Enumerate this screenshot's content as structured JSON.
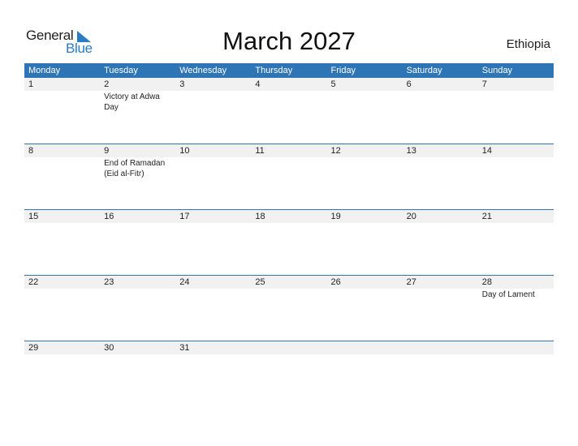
{
  "logo": {
    "part1": "General",
    "part2": "Blue",
    "icon": "triangle-flag-icon"
  },
  "title": "March 2027",
  "country": "Ethiopia",
  "colors": {
    "accent": "#2e75b6",
    "strip": "#f1f1f1"
  },
  "weekdays": [
    "Monday",
    "Tuesday",
    "Wednesday",
    "Thursday",
    "Friday",
    "Saturday",
    "Sunday"
  ],
  "weeks": [
    {
      "days": [
        {
          "num": "1",
          "event": ""
        },
        {
          "num": "2",
          "event": "Victory at Adwa Day"
        },
        {
          "num": "3",
          "event": ""
        },
        {
          "num": "4",
          "event": ""
        },
        {
          "num": "5",
          "event": ""
        },
        {
          "num": "6",
          "event": ""
        },
        {
          "num": "7",
          "event": ""
        }
      ]
    },
    {
      "days": [
        {
          "num": "8",
          "event": ""
        },
        {
          "num": "9",
          "event": "End of Ramadan (Eid al-Fitr)"
        },
        {
          "num": "10",
          "event": ""
        },
        {
          "num": "11",
          "event": ""
        },
        {
          "num": "12",
          "event": ""
        },
        {
          "num": "13",
          "event": ""
        },
        {
          "num": "14",
          "event": ""
        }
      ]
    },
    {
      "days": [
        {
          "num": "15",
          "event": ""
        },
        {
          "num": "16",
          "event": ""
        },
        {
          "num": "17",
          "event": ""
        },
        {
          "num": "18",
          "event": ""
        },
        {
          "num": "19",
          "event": ""
        },
        {
          "num": "20",
          "event": ""
        },
        {
          "num": "21",
          "event": ""
        }
      ]
    },
    {
      "days": [
        {
          "num": "22",
          "event": ""
        },
        {
          "num": "23",
          "event": ""
        },
        {
          "num": "24",
          "event": ""
        },
        {
          "num": "25",
          "event": ""
        },
        {
          "num": "26",
          "event": ""
        },
        {
          "num": "27",
          "event": ""
        },
        {
          "num": "28",
          "event": "Day of Lament"
        }
      ]
    },
    {
      "days": [
        {
          "num": "29",
          "event": ""
        },
        {
          "num": "30",
          "event": ""
        },
        {
          "num": "31",
          "event": ""
        },
        {
          "num": "",
          "event": ""
        },
        {
          "num": "",
          "event": ""
        },
        {
          "num": "",
          "event": ""
        },
        {
          "num": "",
          "event": ""
        }
      ]
    }
  ]
}
